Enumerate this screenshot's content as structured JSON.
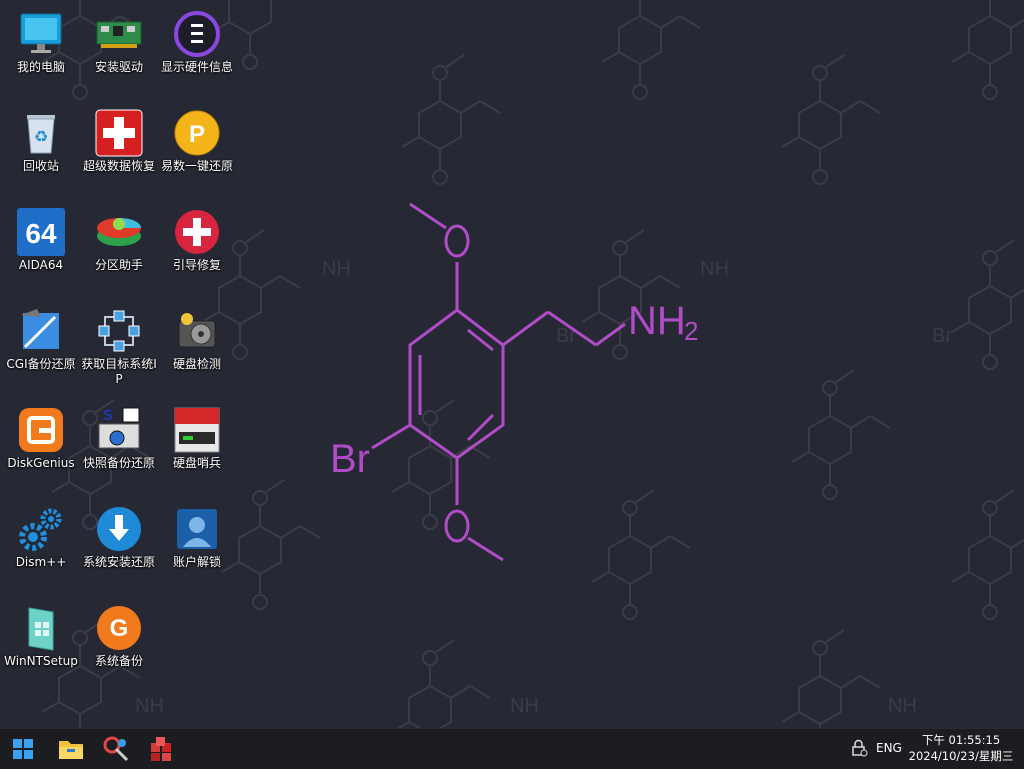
{
  "desktop": {
    "icons": [
      {
        "label": "我的电脑",
        "icon": "computer-icon"
      },
      {
        "label": "安装驱动",
        "icon": "driver-icon"
      },
      {
        "label": "显示硬件信息",
        "icon": "hardware-info-icon"
      },
      {
        "label": "回收站",
        "icon": "recycle-bin-icon"
      },
      {
        "label": "超级数据恢复",
        "icon": "data-recovery-icon"
      },
      {
        "label": "易数一键还原",
        "icon": "restore-icon"
      },
      {
        "label": "AIDA64",
        "icon": "aida64-icon"
      },
      {
        "label": "分区助手",
        "icon": "partition-icon"
      },
      {
        "label": "引导修复",
        "icon": "boot-repair-icon"
      },
      {
        "label": "CGI备份还原",
        "icon": "cgi-icon"
      },
      {
        "label": "获取目标系统IP",
        "icon": "network-ip-icon"
      },
      {
        "label": "硬盘检测",
        "icon": "disk-check-icon"
      },
      {
        "label": "DiskGenius",
        "icon": "diskgenius-icon"
      },
      {
        "label": "快照备份还原",
        "icon": "snapshot-icon"
      },
      {
        "label": "硬盘哨兵",
        "icon": "disk-sentinel-icon"
      },
      {
        "label": "Dism++",
        "icon": "dism-icon"
      },
      {
        "label": "系统安装还原",
        "icon": "system-install-icon"
      },
      {
        "label": "账户解锁",
        "icon": "account-unlock-icon"
      },
      {
        "label": "WinNTSetup",
        "icon": "winntsetup-icon"
      },
      {
        "label": "系统备份",
        "icon": "system-backup-icon"
      }
    ]
  },
  "wallpaper": {
    "atom_br": "Br",
    "atom_o": "O",
    "group_nh2": "NH",
    "subscript": "2",
    "accent": "#b04cc8",
    "pattern_color": "#3a3c47"
  },
  "taskbar": {
    "pinned": [
      "start-icon",
      "file-explorer-icon",
      "tools-icon",
      "package-icon"
    ],
    "language": "ENG",
    "time": "下午 01:55:15",
    "date": "2024/10/23/星期三"
  }
}
